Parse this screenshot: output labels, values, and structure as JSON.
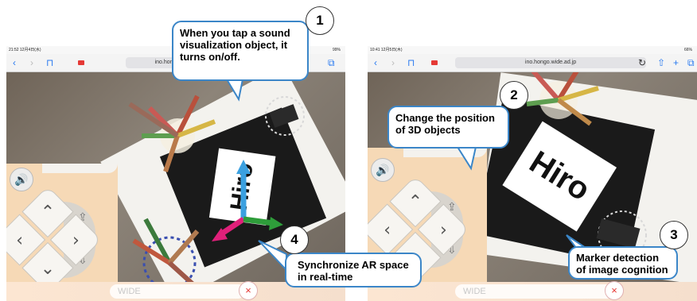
{
  "left": {
    "status_time": "21:52  12月4日(水)",
    "status_battery": "99%",
    "url": "ino.hong",
    "marker_text": "Hiro",
    "wide_placeholder": "WIDE",
    "close_glyph": "×"
  },
  "right": {
    "status_time": "10:41  12月5日(木)",
    "status_battery": "66%",
    "url": "ino.hongo.wide.ad.jp",
    "marker_text": "Hiro",
    "wide_placeholder": "WIDE",
    "close_glyph": "×"
  },
  "icons": {
    "back": "‹",
    "forward": "›",
    "bookmarks": "⊓",
    "reload": "↻",
    "share": "⇧",
    "add": "+",
    "tabs": "⧉",
    "speaker": "🔊",
    "up": "⌃",
    "down": "⌄",
    "left": "‹",
    "right": "›",
    "raise": "⇪",
    "lower": "⇩"
  },
  "callouts": [
    {
      "number": "1",
      "text": "When you tap a sound visualization object, it turns on/off."
    },
    {
      "number": "2",
      "text": "Change the position of 3D objects"
    },
    {
      "number": "3",
      "text": "Marker detection of image cognition"
    },
    {
      "number": "4",
      "text": "Synchronize AR space in real-time"
    }
  ],
  "colors": {
    "callout_border": "#3b86c8",
    "panel": "#f6d9b6",
    "axis_x": "#2e9d3a",
    "axis_y": "#3aa0e0",
    "axis_z": "#e0207a",
    "record": "#e53935"
  }
}
